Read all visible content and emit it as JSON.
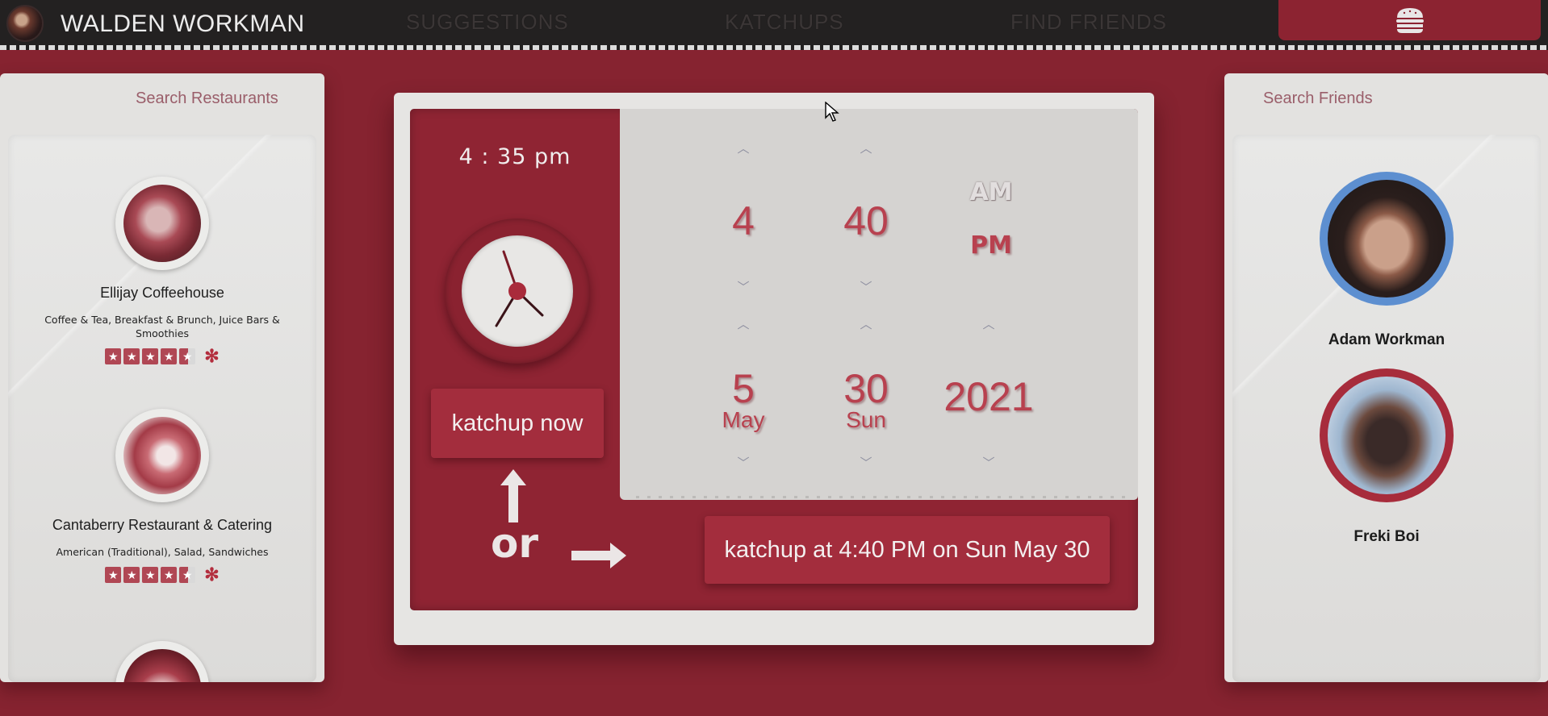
{
  "header": {
    "brand": "WALDEN WORKMAN",
    "nav": [
      "SUGGESTIONS",
      "KATCHUPS",
      "FIND FRIENDS"
    ],
    "menu_icon": "burger-icon"
  },
  "restaurants_panel": {
    "search_placeholder": "Search Restaurants",
    "items": [
      {
        "name": "Ellijay Coffeehouse",
        "categories": "Coffee & Tea, Breakfast & Brunch, Juice Bars & Smoothies",
        "rating": 4.5
      },
      {
        "name": "Cantaberry Restaurant & Catering",
        "categories": "American (Traditional), Salad, Sandwiches",
        "rating": 4.5
      },
      {
        "name": "",
        "categories": "",
        "rating": null
      }
    ]
  },
  "friends_panel": {
    "search_placeholder": "Search Friends",
    "friends": [
      {
        "name": "Adam Workman"
      },
      {
        "name": "Freki Boi"
      }
    ]
  },
  "scheduler": {
    "current_time": "4 : 35 pm",
    "now_button": "katchup now",
    "or_label": "or",
    "hour": "4",
    "minute": "40",
    "am": "AM",
    "pm": "PM",
    "month_day": "5",
    "month_name": "May",
    "day": "30",
    "weekday": "Sun",
    "year": "2021",
    "schedule_button": "katchup at 4:40 PM on Sun May 30"
  },
  "colors": {
    "background": "#862330",
    "accent": "#8f2433",
    "button": "#a32d3d",
    "panel": "#e3e2e0",
    "friend_ring_active": "#5d8fd0",
    "friend_ring": "#a72c3c"
  }
}
